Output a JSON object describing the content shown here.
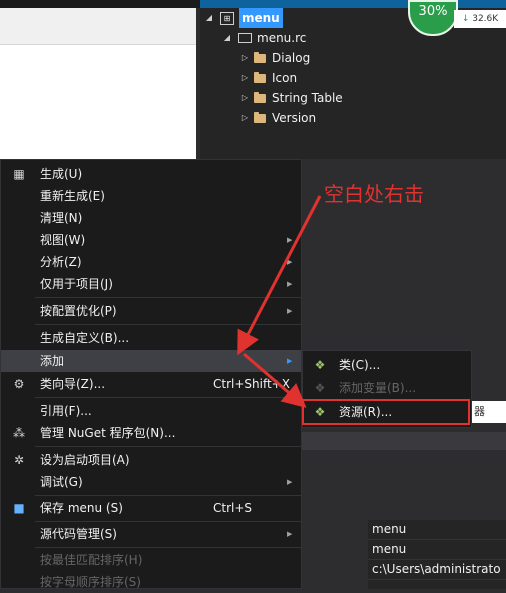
{
  "resource_view": {
    "root_label": "menu",
    "file_label": "menu.rc",
    "folders": [
      "Dialog",
      "Icon",
      "String Table",
      "Version"
    ]
  },
  "badge": {
    "percent": "30%",
    "speed": "32.6K"
  },
  "annotation": {
    "text": "空白处右击"
  },
  "context_menu": {
    "items": [
      {
        "label": "生成(U)",
        "icon": "build-icon"
      },
      {
        "label": "重新生成(E)"
      },
      {
        "label": "清理(N)"
      },
      {
        "label": "视图(W)",
        "submenu": true
      },
      {
        "label": "分析(Z)",
        "submenu": true
      },
      {
        "label": "仅用于项目(J)",
        "submenu": true
      },
      {
        "label": "按配置优化(P)",
        "submenu": true
      },
      {
        "label": "生成自定义(B)..."
      },
      {
        "label": "添加",
        "submenu": true,
        "highlighted": true
      },
      {
        "label": "类向导(Z)...",
        "shortcut": "Ctrl+Shift+X",
        "icon": "class-wizard-icon"
      },
      {
        "label": "引用(F)..."
      },
      {
        "label": "管理 NuGet 程序包(N)...",
        "icon": "nuget-icon"
      },
      {
        "label": "设为启动项目(A)",
        "icon": "gear-icon"
      },
      {
        "label": "调试(G)",
        "submenu": true
      },
      {
        "label": "保存 menu (S)",
        "shortcut": "Ctrl+S",
        "icon": "save-icon"
      },
      {
        "label": "源代码管理(S)",
        "submenu": true
      },
      {
        "label": "按最佳匹配排序(H)",
        "disabled": true
      },
      {
        "label": "按字母顺序排序(S)",
        "disabled": true
      }
    ]
  },
  "add_submenu": {
    "items": [
      {
        "label": "类(C)..."
      },
      {
        "label": "添加变量(B)...",
        "disabled": true
      },
      {
        "label": "资源(R)..."
      }
    ]
  },
  "right_tab": {
    "label": "器"
  },
  "properties": {
    "rows": [
      "menu",
      "menu",
      "c:\\Users\\administrato"
    ]
  },
  "colors": {
    "accent": "#3399ff",
    "annotation": "#e0322f",
    "menu_bg": "#1b1b1c"
  }
}
